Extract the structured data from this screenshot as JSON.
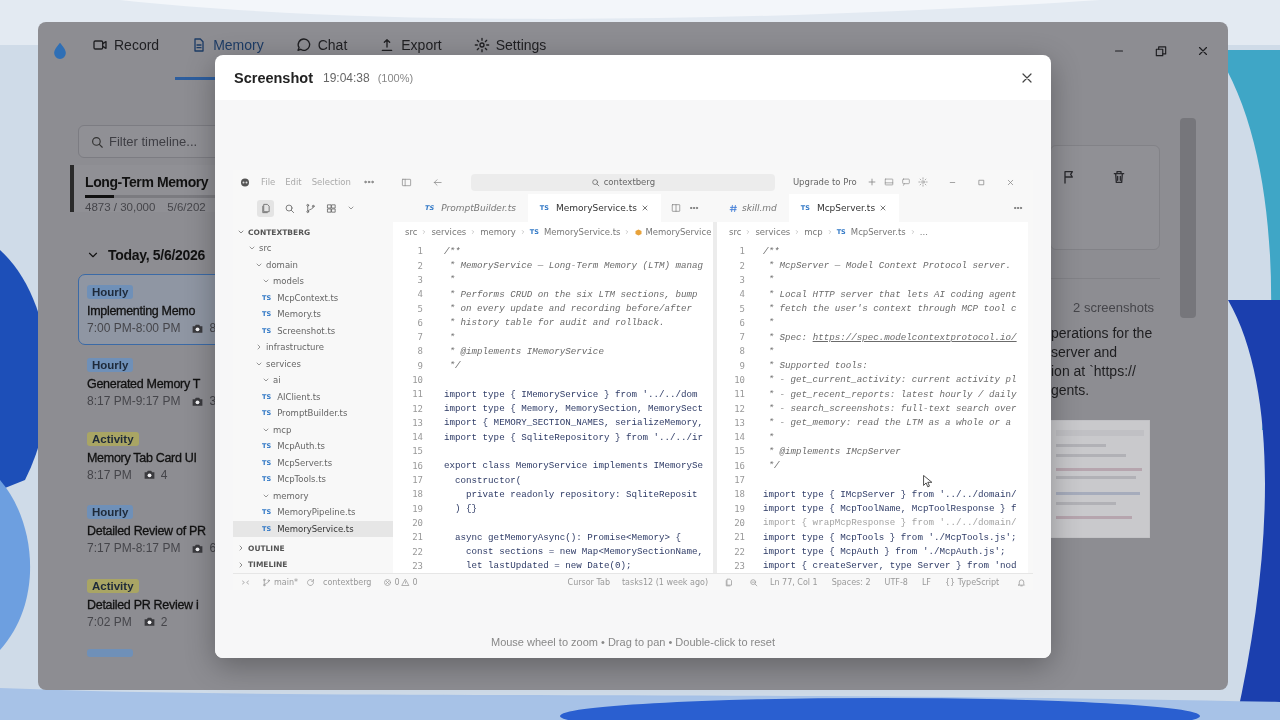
{
  "app": {
    "tabs": [
      {
        "label": "Record",
        "selected": false
      },
      {
        "label": "Memory",
        "selected": true
      },
      {
        "label": "Chat",
        "selected": false
      },
      {
        "label": "Export",
        "selected": false
      },
      {
        "label": "Settings",
        "selected": false
      }
    ],
    "search": {
      "placeholder": "Filter timeline..."
    },
    "memory_card": {
      "title": "Long-Term Memory",
      "level": 0.16,
      "usage": "4873 / 30,000",
      "date": "5/6/202"
    },
    "day": {
      "label": "Today, 5/6/2026",
      "expanded": true
    },
    "timeline": [
      {
        "badge": "Hourly",
        "color": "#6f90b8",
        "title": "Implementing Memo",
        "time": "7:00 PM-8:00 PM",
        "count": "8",
        "selected": true
      },
      {
        "badge": "Hourly",
        "color": "#6f90b8",
        "title": "Generated Memory T",
        "time": "8:17 PM-9:17 PM",
        "count": "3",
        "selected": false
      },
      {
        "badge": "Activity",
        "color": "#a9a564",
        "title": "Memory Tab Card UI",
        "time": "8:17 PM",
        "count": "4",
        "selected": false
      },
      {
        "badge": "Hourly",
        "color": "#6f90b8",
        "title": "Detailed Review of PR",
        "time": "7:17 PM-8:17 PM",
        "count": "6",
        "selected": false
      },
      {
        "badge": "Activity",
        "color": "#a9a564",
        "title": "Detailed PR Review i",
        "time": "7:02 PM",
        "count": "2",
        "selected": false
      },
      {
        "color": "#6f90b8",
        "selected": false
      }
    ],
    "detail": {
      "count_label": "2 screenshots",
      "lines": [
        "perations for the",
        "server and",
        "ion at `https://",
        "gents."
      ]
    }
  },
  "modal": {
    "title": "Screenshot",
    "time": "19:04:38",
    "zoom": "(100%)",
    "hint": "Mouse wheel to zoom • Drag to pan • Double-click to reset",
    "screenshot": {
      "menu": [
        "File",
        "Edit",
        "Selection"
      ],
      "search": "contextberg",
      "upgrade": "Upgrade to Pro",
      "explorer": {
        "title": "CONTEXTBERG",
        "expanded": true,
        "tree": [
          {
            "name": "src",
            "kind": "folder",
            "expanded": true,
            "selected": false,
            "children": [
              {
                "name": "domain",
                "kind": "folder",
                "expanded": true,
                "selected": false,
                "children": [
                  {
                    "name": "models",
                    "kind": "folder",
                    "expanded": true,
                    "selected": false,
                    "children": [
                      {
                        "name": "McpContext.ts",
                        "kind": "file",
                        "icon": "TS",
                        "selected": false
                      },
                      {
                        "name": "Memory.ts",
                        "kind": "file",
                        "icon": "TS",
                        "selected": false
                      },
                      {
                        "name": "Screenshot.ts",
                        "kind": "file",
                        "icon": "TS",
                        "selected": false
                      }
                    ]
                  }
                ]
              },
              {
                "name": "infrastructure",
                "kind": "folder",
                "expanded": false,
                "selected": false
              },
              {
                "name": "services",
                "kind": "folder",
                "expanded": true,
                "selected": false,
                "children": [
                  {
                    "name": "ai",
                    "kind": "folder",
                    "expanded": true,
                    "selected": false,
                    "children": [
                      {
                        "name": "AIClient.ts",
                        "kind": "file",
                        "icon": "TS",
                        "selected": false
                      },
                      {
                        "name": "PromptBuilder.ts",
                        "kind": "file",
                        "icon": "TS",
                        "selected": false
                      }
                    ]
                  },
                  {
                    "name": "mcp",
                    "kind": "folder",
                    "expanded": true,
                    "selected": false,
                    "children": [
                      {
                        "name": "McpAuth.ts",
                        "kind": "file",
                        "icon": "TS",
                        "selected": false
                      },
                      {
                        "name": "McpServer.ts",
                        "kind": "file",
                        "icon": "TS",
                        "selected": false
                      },
                      {
                        "name": "McpTools.ts",
                        "kind": "file",
                        "icon": "TS",
                        "selected": false
                      }
                    ]
                  },
                  {
                    "name": "memory",
                    "kind": "folder",
                    "expanded": true,
                    "selected": false,
                    "children": [
                      {
                        "name": "MemoryPipeline.ts",
                        "kind": "file",
                        "icon": "TS",
                        "selected": false
                      },
                      {
                        "name": "MemoryService.ts",
                        "kind": "file",
                        "icon": "TS",
                        "selected": true
                      }
                    ]
                  }
                ]
              }
            ]
          }
        ],
        "sections": [
          {
            "label": "OUTLINE",
            "expanded": false
          },
          {
            "label": "TIMELINE",
            "expanded": false
          }
        ]
      },
      "editors": [
        {
          "tabs": [
            {
              "label": "PromptBuilder.ts",
              "kind": "ts",
              "icon": "TS",
              "preview": true,
              "selected": false
            },
            {
              "label": "MemoryService.ts",
              "kind": "ts",
              "icon": "TS",
              "preview": false,
              "selected": true
            }
          ],
          "crumbs": [
            {
              "label": "src"
            },
            {
              "label": "services"
            },
            {
              "label": "memory"
            },
            {
              "label": "MemoryService.ts",
              "icon": "TS"
            },
            {
              "label": "MemoryService",
              "kind": "class"
            }
          ],
          "lines": [
            {
              "n": "1",
              "text": "/**",
              "kind": "comment"
            },
            {
              "n": "2",
              "text": " * MemoryService — Long-Term Memory (LTM) manag",
              "kind": "comment"
            },
            {
              "n": "3",
              "text": " *",
              "kind": "comment"
            },
            {
              "n": "4",
              "text": " * Performs CRUD on the six LTM sections, bump",
              "kind": "comment"
            },
            {
              "n": "5",
              "text": " * on every update and recording before/after",
              "kind": "comment"
            },
            {
              "n": "6",
              "text": " * history table for audit and rollback.",
              "kind": "comment"
            },
            {
              "n": "7",
              "text": " *",
              "kind": "comment"
            },
            {
              "n": "8",
              "text": " * @implements IMemoryService",
              "kind": "comment"
            },
            {
              "n": "9",
              "text": " */",
              "kind": "comment"
            },
            {
              "n": "10",
              "kind": "code"
            },
            {
              "n": "11",
              "text": "import type { IMemoryService } from '../../dom",
              "kind": "code"
            },
            {
              "n": "12",
              "text": "import type { Memory, MemorySection, MemorySect",
              "kind": "code"
            },
            {
              "n": "13",
              "text": "import { MEMORY_SECTION_NAMES, serializeMemory,",
              "kind": "code"
            },
            {
              "n": "14",
              "text": "import type { SqliteRepository } from '../../ir",
              "kind": "code"
            },
            {
              "n": "15",
              "kind": "code"
            },
            {
              "n": "16",
              "text": "export class MemoryService implements IMemorySe",
              "kind": "code"
            },
            {
              "n": "17",
              "text": "  constructor(",
              "kind": "code"
            },
            {
              "n": "18",
              "text": "    private readonly repository: SqliteReposit",
              "kind": "code"
            },
            {
              "n": "19",
              "text": "  ) {}",
              "kind": "code"
            },
            {
              "n": "20",
              "kind": "code"
            },
            {
              "n": "21",
              "text": "  async getMemoryAsync(): Promise<Memory> {",
              "kind": "code"
            },
            {
              "n": "22",
              "text": "    const sections = new Map<MemorySectionName,",
              "kind": "code"
            },
            {
              "n": "23",
              "text": "    let lastUpdated = new Date(0);",
              "kind": "code"
            }
          ]
        },
        {
          "tabs": [
            {
              "label": "skill.md",
              "kind": "md",
              "preview": true,
              "selected": false
            },
            {
              "label": "McpServer.ts",
              "kind": "ts",
              "icon": "TS",
              "preview": false,
              "selected": true
            }
          ],
          "crumbs": [
            {
              "label": "src"
            },
            {
              "label": "services"
            },
            {
              "label": "mcp"
            },
            {
              "label": "McpServer.ts",
              "icon": "TS"
            },
            {
              "label": "..."
            }
          ],
          "lines": [
            {
              "n": "1",
              "text": "/**",
              "kind": "comment"
            },
            {
              "n": "2",
              "text": " * McpServer — Model Context Protocol server.",
              "kind": "comment"
            },
            {
              "n": "3",
              "text": " *",
              "kind": "comment"
            },
            {
              "n": "4",
              "text": " * Local HTTP server that lets AI coding agent",
              "kind": "comment"
            },
            {
              "n": "5",
              "text": " * fetch the user's context through MCP tool c",
              "kind": "comment"
            },
            {
              "n": "6",
              "text": " *",
              "kind": "comment"
            },
            {
              "n": "7",
              "text": " * Spec: ",
              "link": "https://spec.modelcontextprotocol.io/",
              "kind": "comment"
            },
            {
              "n": "8",
              "text": " *",
              "kind": "comment"
            },
            {
              "n": "9",
              "text": " * Supported tools:",
              "kind": "comment"
            },
            {
              "n": "10",
              "text": " * - get_current_activity: current activity pl",
              "kind": "comment"
            },
            {
              "n": "11",
              "text": " * - get_recent_reports: latest hourly / daily",
              "kind": "comment"
            },
            {
              "n": "12",
              "text": " * - search_screenshots: full-text search over",
              "kind": "comment"
            },
            {
              "n": "13",
              "text": " * - get_memory: read the LTM as a whole or a",
              "kind": "comment"
            },
            {
              "n": "14",
              "text": " *",
              "kind": "comment"
            },
            {
              "n": "15",
              "text": " * @implements IMcpServer",
              "kind": "comment"
            },
            {
              "n": "16",
              "text": " */",
              "kind": "comment"
            },
            {
              "n": "17",
              "kind": "code"
            },
            {
              "n": "18",
              "text": "import type { IMcpServer } from '../../domain/",
              "kind": "code"
            },
            {
              "n": "19",
              "text": "import type { McpToolName, McpToolResponse } f",
              "kind": "code"
            },
            {
              "n": "20",
              "text": "import { wrapMcpResponse } from '../../domain/",
              "kind": "faded"
            },
            {
              "n": "21",
              "text": "import type { McpTools } from './McpTools.js';",
              "kind": "code"
            },
            {
              "n": "22",
              "text": "import type { McpAuth } from './McpAuth.js';",
              "kind": "code"
            },
            {
              "n": "23",
              "text": "import { createServer, type Server } from 'nod",
              "kind": "code"
            }
          ]
        }
      ],
      "status": {
        "branch": "main*",
        "repo": "contextberg",
        "errors": "0",
        "warnings": "0",
        "center": [
          "Cursor Tab",
          "tasks12 (1 week ago)"
        ],
        "right": [
          "Ln 77, Col 1",
          "Spaces: 2",
          "UTF-8",
          "LF",
          "{} TypeScript"
        ]
      }
    }
  }
}
